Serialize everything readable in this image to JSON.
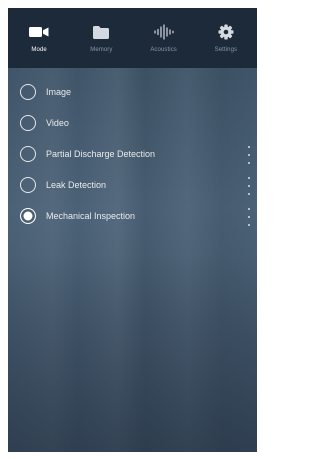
{
  "tabs": [
    {
      "label": "Mode",
      "icon": "video-camera-icon",
      "active": true
    },
    {
      "label": "Memory",
      "icon": "folder-icon",
      "active": false
    },
    {
      "label": "Acoustics",
      "icon": "sound-wave-icon",
      "active": false
    },
    {
      "label": "Settings",
      "icon": "gear-icon",
      "active": false
    }
  ],
  "modes": [
    {
      "label": "Image",
      "selected": false,
      "has_menu": false
    },
    {
      "label": "Video",
      "selected": false,
      "has_menu": false
    },
    {
      "label": "Partial Discharge Detection",
      "selected": false,
      "has_menu": true
    },
    {
      "label": "Leak Detection",
      "selected": false,
      "has_menu": true
    },
    {
      "label": "Mechanical Inspection",
      "selected": true,
      "has_menu": true
    }
  ],
  "colors": {
    "nav_background": "#1d2a3a",
    "active_label": "#ffffff",
    "inactive_label": "#8b96a6",
    "content_background": "#4b6176"
  }
}
